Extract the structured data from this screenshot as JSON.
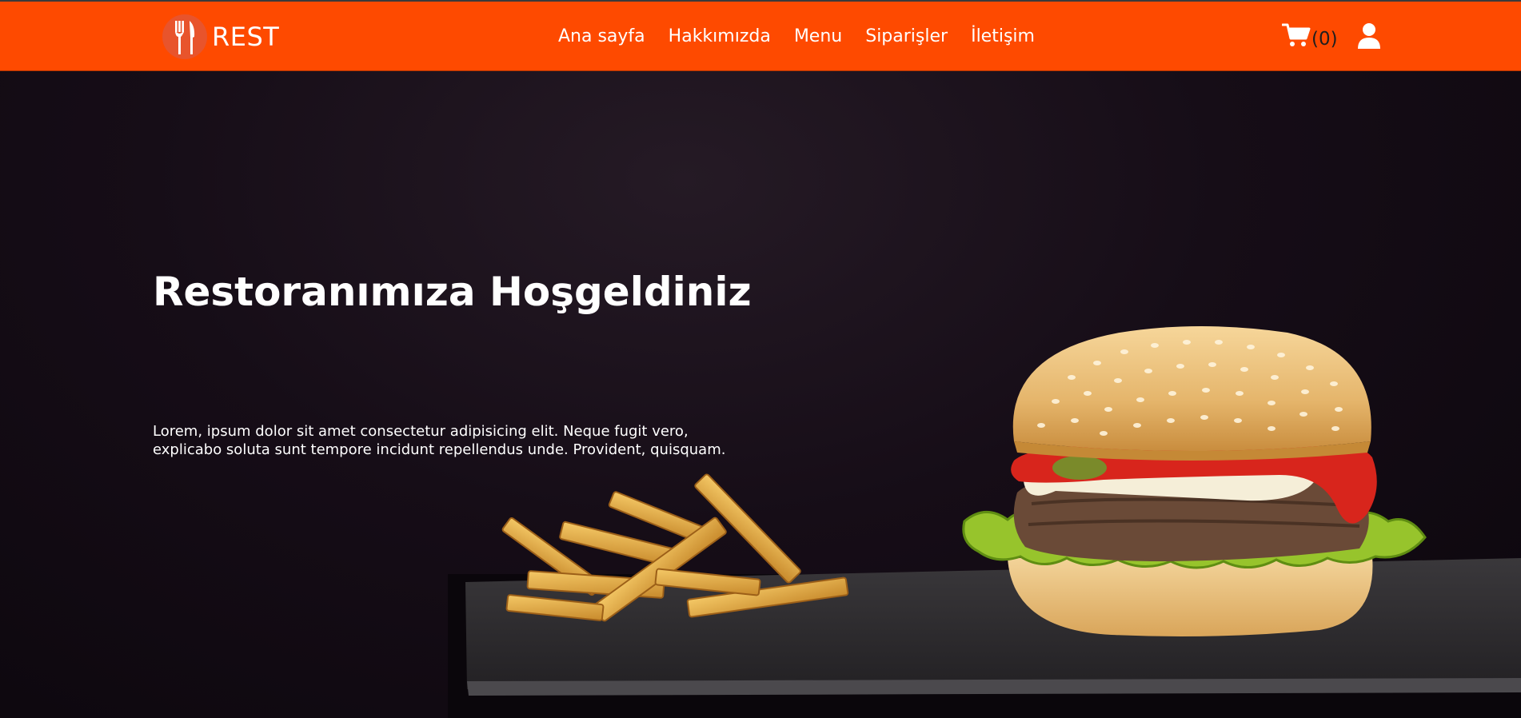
{
  "nav": {
    "brand": "REST",
    "links": [
      "Ana sayfa",
      "Hakkımızda",
      "Menu",
      "Siparişler",
      "İletişim"
    ],
    "cart_count": "(0)"
  },
  "hero": {
    "title": "Restoranımıza Hoşgeldiniz",
    "text": "Lorem, ipsum dolor sit amet consectetur adipisicing elit. Neque fugit vero, explicabo soluta sunt tempore incidunt repellendus unde. Provident, quisquam."
  },
  "icons": {
    "brand_logo": "fork-knife-icon",
    "cart": "cart-icon",
    "user": "user-icon"
  },
  "colors": {
    "navbar": "#fe4a00",
    "hero_background": "#120b13",
    "text": "#ffffff"
  }
}
